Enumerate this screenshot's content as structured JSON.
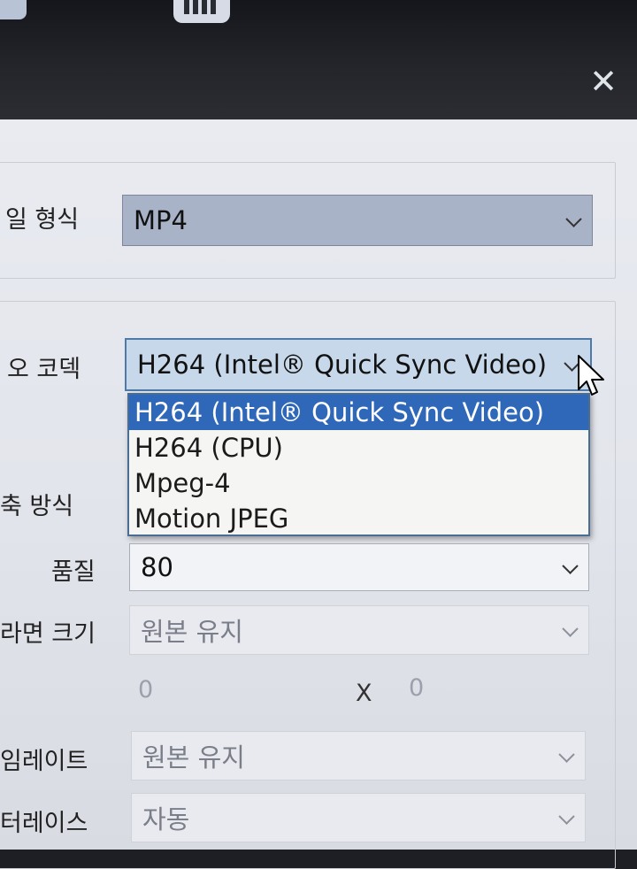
{
  "window": {
    "close_glyph": "✕"
  },
  "form": {
    "file_format": {
      "label": "일 형식",
      "value": "MP4"
    },
    "video_codec": {
      "label": "오 코덱",
      "value": "H264 (Intel® Quick Sync Video)"
    },
    "codec_options": [
      "H264 (Intel® Quick Sync Video)",
      "H264 (CPU)",
      "Mpeg-4",
      "Motion JPEG"
    ],
    "compression": {
      "label": "축 방식"
    },
    "quality": {
      "label": "품질",
      "value": "80"
    },
    "screen_size": {
      "label": "라면 크기",
      "value": "원본 유지"
    },
    "dimensions": {
      "width": "0",
      "separator": "X",
      "height": "0"
    },
    "frame_rate": {
      "label": "임레이트",
      "value": "원본 유지"
    },
    "interlace": {
      "label": "터레이스",
      "value": "자동"
    }
  },
  "colors": {
    "selection": "#2f68b8",
    "dropdown_border": "#4a6d94"
  }
}
